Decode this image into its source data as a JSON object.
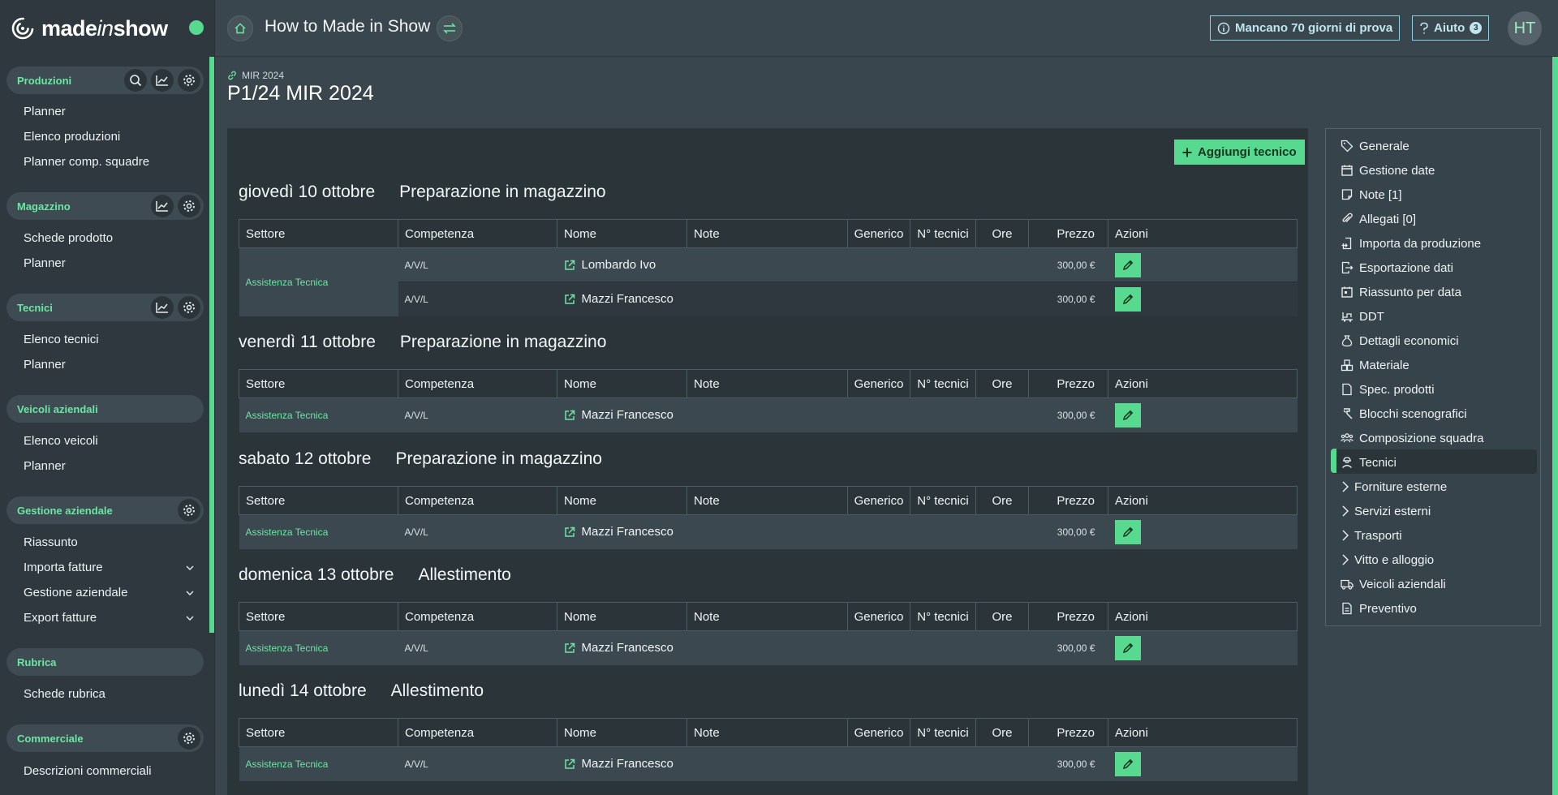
{
  "brand": {
    "name_pre": "made",
    "name_ital": "in",
    "name_post": "show"
  },
  "header": {
    "title": "How to Made in Show",
    "trial": "Mancano 70 giorni di prova",
    "help": "Aiuto",
    "help_badge": "3",
    "avatar": "HT"
  },
  "sidebar": {
    "produzioni": {
      "title": "Produzioni",
      "items": [
        "Planner",
        "Elenco produzioni",
        "Planner comp. squadre"
      ]
    },
    "magazzino": {
      "title": "Magazzino",
      "items": [
        "Schede prodotto",
        "Planner"
      ]
    },
    "tecnici": {
      "title": "Tecnici",
      "items": [
        "Elenco tecnici",
        "Planner"
      ]
    },
    "veicoli": {
      "title": "Veicoli aziendali",
      "items": [
        "Elenco veicoli",
        "Planner"
      ]
    },
    "gestione": {
      "title": "Gestione aziendale",
      "items": [
        "Riassunto",
        "Importa fatture",
        "Gestione aziendale",
        "Export fatture"
      ]
    },
    "rubrica": {
      "title": "Rubrica",
      "items": [
        "Schede rubrica"
      ]
    },
    "commerciale": {
      "title": "Commerciale",
      "items": [
        "Descrizioni commerciali"
      ]
    }
  },
  "production": {
    "breadcrumb": "MIR 2024",
    "title": "P1/24 MIR 2024"
  },
  "add_button": "Aggiungi tecnico",
  "columns": [
    "Settore",
    "Competenza",
    "Nome",
    "Note",
    "Generico",
    "N° tecnici",
    "Ore",
    "Prezzo",
    "Azioni"
  ],
  "days": [
    {
      "date": "giovedì 10 ottobre",
      "activity": "Preparazione in magazzino",
      "rows": [
        {
          "settore": "Assistenza Tecnica",
          "competenza": "A/V/L",
          "nome": "Lombardo Ivo",
          "prezzo": "300,00 €"
        },
        {
          "settore": "",
          "competenza": "A/V/L",
          "nome": "Mazzi Francesco",
          "prezzo": "300,00 €"
        }
      ]
    },
    {
      "date": "venerdì 11 ottobre",
      "activity": "Preparazione in magazzino",
      "rows": [
        {
          "settore": "Assistenza Tecnica",
          "competenza": "A/V/L",
          "nome": "Mazzi Francesco",
          "prezzo": "300,00 €"
        }
      ]
    },
    {
      "date": "sabato 12 ottobre",
      "activity": "Preparazione in magazzino",
      "rows": [
        {
          "settore": "Assistenza Tecnica",
          "competenza": "A/V/L",
          "nome": "Mazzi Francesco",
          "prezzo": "300,00 €"
        }
      ]
    },
    {
      "date": "domenica 13 ottobre",
      "activity": "Allestimento",
      "rows": [
        {
          "settore": "Assistenza Tecnica",
          "competenza": "A/V/L",
          "nome": "Mazzi Francesco",
          "prezzo": "300,00 €"
        }
      ]
    },
    {
      "date": "lunedì 14 ottobre",
      "activity": "Allestimento",
      "rows": [
        {
          "settore": "Assistenza Tecnica",
          "competenza": "A/V/L",
          "nome": "Mazzi Francesco",
          "prezzo": "300,00 €"
        }
      ]
    }
  ],
  "right_nav": [
    {
      "label": "Generale",
      "icon": "tag-icon"
    },
    {
      "label": "Gestione date",
      "icon": "calendar-icon"
    },
    {
      "label": "Note [1]",
      "icon": "note-icon"
    },
    {
      "label": "Allegati [0]",
      "icon": "paperclip-icon"
    },
    {
      "label": "Importa da produzione",
      "icon": "import-icon"
    },
    {
      "label": "Esportazione dati",
      "icon": "export-icon"
    },
    {
      "label": "Riassunto per data",
      "icon": "calendar-day-icon"
    },
    {
      "label": "DDT",
      "icon": "truck-load-icon"
    },
    {
      "label": "Dettagli economici",
      "icon": "money-bag-icon"
    },
    {
      "label": "Materiale",
      "icon": "boxes-icon"
    },
    {
      "label": "Spec. prodotti",
      "icon": "document-icon"
    },
    {
      "label": "Blocchi scenografici",
      "icon": "hammer-icon"
    },
    {
      "label": "Composizione squadra",
      "icon": "team-icon"
    },
    {
      "label": "Tecnici",
      "icon": "worker-icon",
      "active": true
    },
    {
      "label": "Forniture esterne",
      "icon": "chevron-right-icon"
    },
    {
      "label": "Servizi esterni",
      "icon": "chevron-right-icon"
    },
    {
      "label": "Trasporti",
      "icon": "chevron-right-icon"
    },
    {
      "label": "Vitto e alloggio",
      "icon": "chevron-right-icon"
    },
    {
      "label": "Veicoli aziendali",
      "icon": "truck-icon"
    },
    {
      "label": "Preventivo",
      "icon": "file-icon"
    }
  ],
  "colors": {
    "accent": "#57d98f",
    "sidebar_bg": "#2e383e",
    "main_bg": "#3a464d",
    "panel_bg": "#2b3439"
  }
}
